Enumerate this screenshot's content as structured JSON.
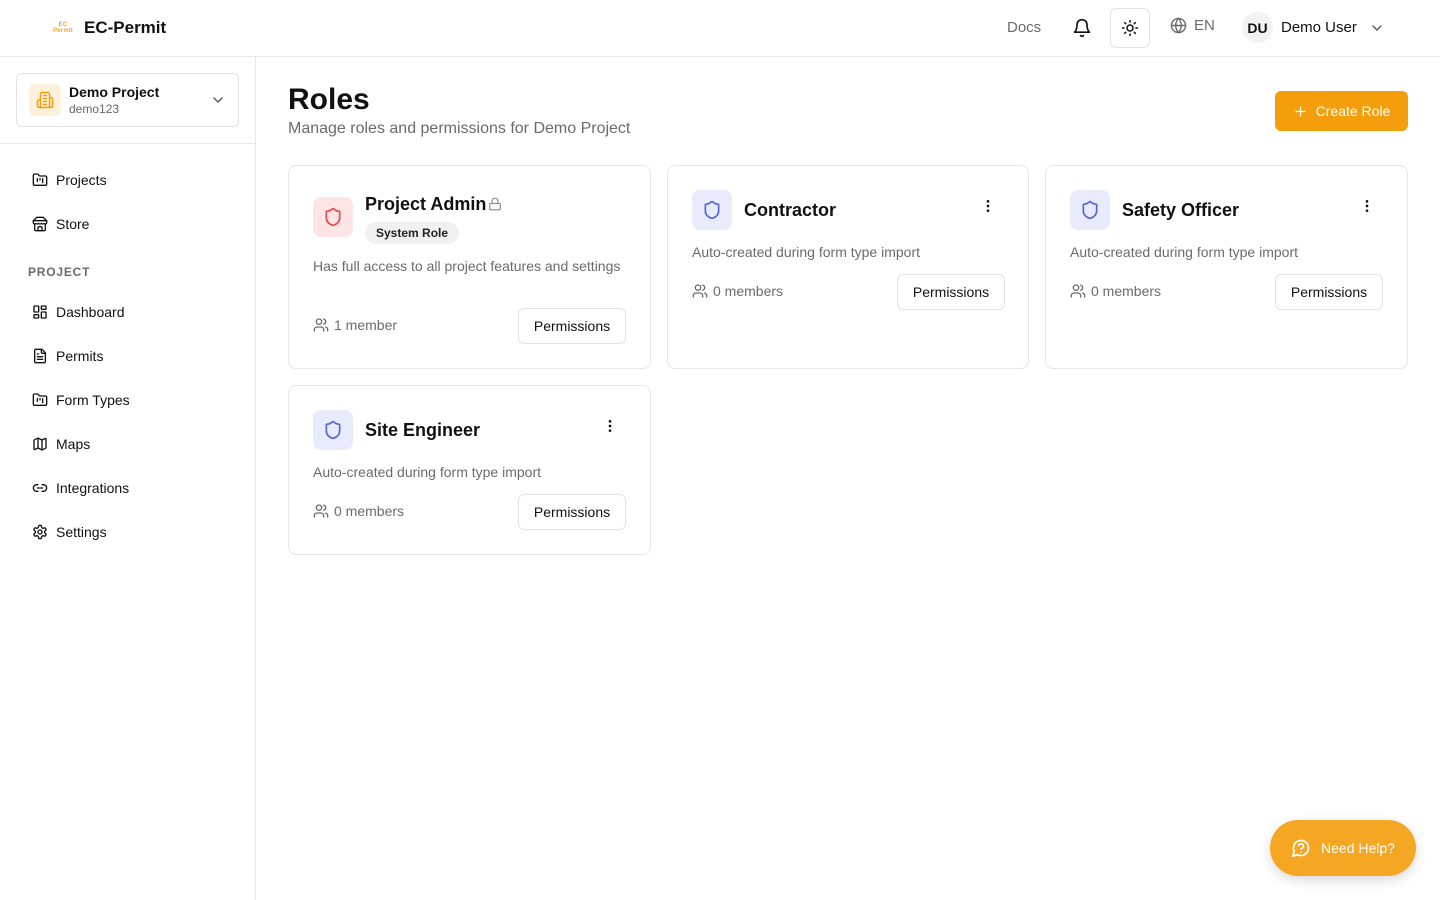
{
  "app": {
    "name": "EC-Permit",
    "logo_text": [
      "EC",
      "Permit"
    ]
  },
  "topbar": {
    "docs_label": "Docs",
    "language": "EN",
    "user_initials": "DU",
    "user_name": "Demo User"
  },
  "project": {
    "name": "Demo Project",
    "code": "demo123"
  },
  "sidebar": {
    "top_items": [
      {
        "label": "Projects",
        "icon": "folder-icon"
      },
      {
        "label": "Store",
        "icon": "store-icon"
      }
    ],
    "section_label": "PROJECT",
    "project_items": [
      {
        "label": "Dashboard",
        "icon": "dashboard-icon"
      },
      {
        "label": "Permits",
        "icon": "file-icon"
      },
      {
        "label": "Form Types",
        "icon": "folder-icon"
      },
      {
        "label": "Maps",
        "icon": "map-icon"
      },
      {
        "label": "Integrations",
        "icon": "link-icon"
      },
      {
        "label": "Settings",
        "icon": "gear-icon"
      }
    ]
  },
  "page": {
    "title": "Roles",
    "subtitle": "Manage roles and permissions for Demo Project",
    "create_label": "Create Role"
  },
  "roles": [
    {
      "name": "Project Admin",
      "badge": "System Role",
      "description": "Has full access to all project features and settings",
      "members": "1 member",
      "button": "Permissions",
      "icon_color": "#e5484d"
    },
    {
      "name": "Contractor",
      "description": "Auto-created during form type import",
      "members": "0 members",
      "button": "Permissions",
      "icon_color": "#5b63d3"
    },
    {
      "name": "Safety Officer",
      "description": "Auto-created during form type import",
      "members": "0 members",
      "button": "Permissions",
      "icon_color": "#5b63d3"
    },
    {
      "name": "Site Engineer",
      "description": "Auto-created during form type import",
      "members": "0 members",
      "button": "Permissions",
      "icon_color": "#5b63d3"
    }
  ],
  "help": {
    "label": "Need Help?"
  },
  "colors": {
    "accent": "#f59e0b",
    "danger": "#e5484d",
    "indigo": "#5b63d3"
  }
}
